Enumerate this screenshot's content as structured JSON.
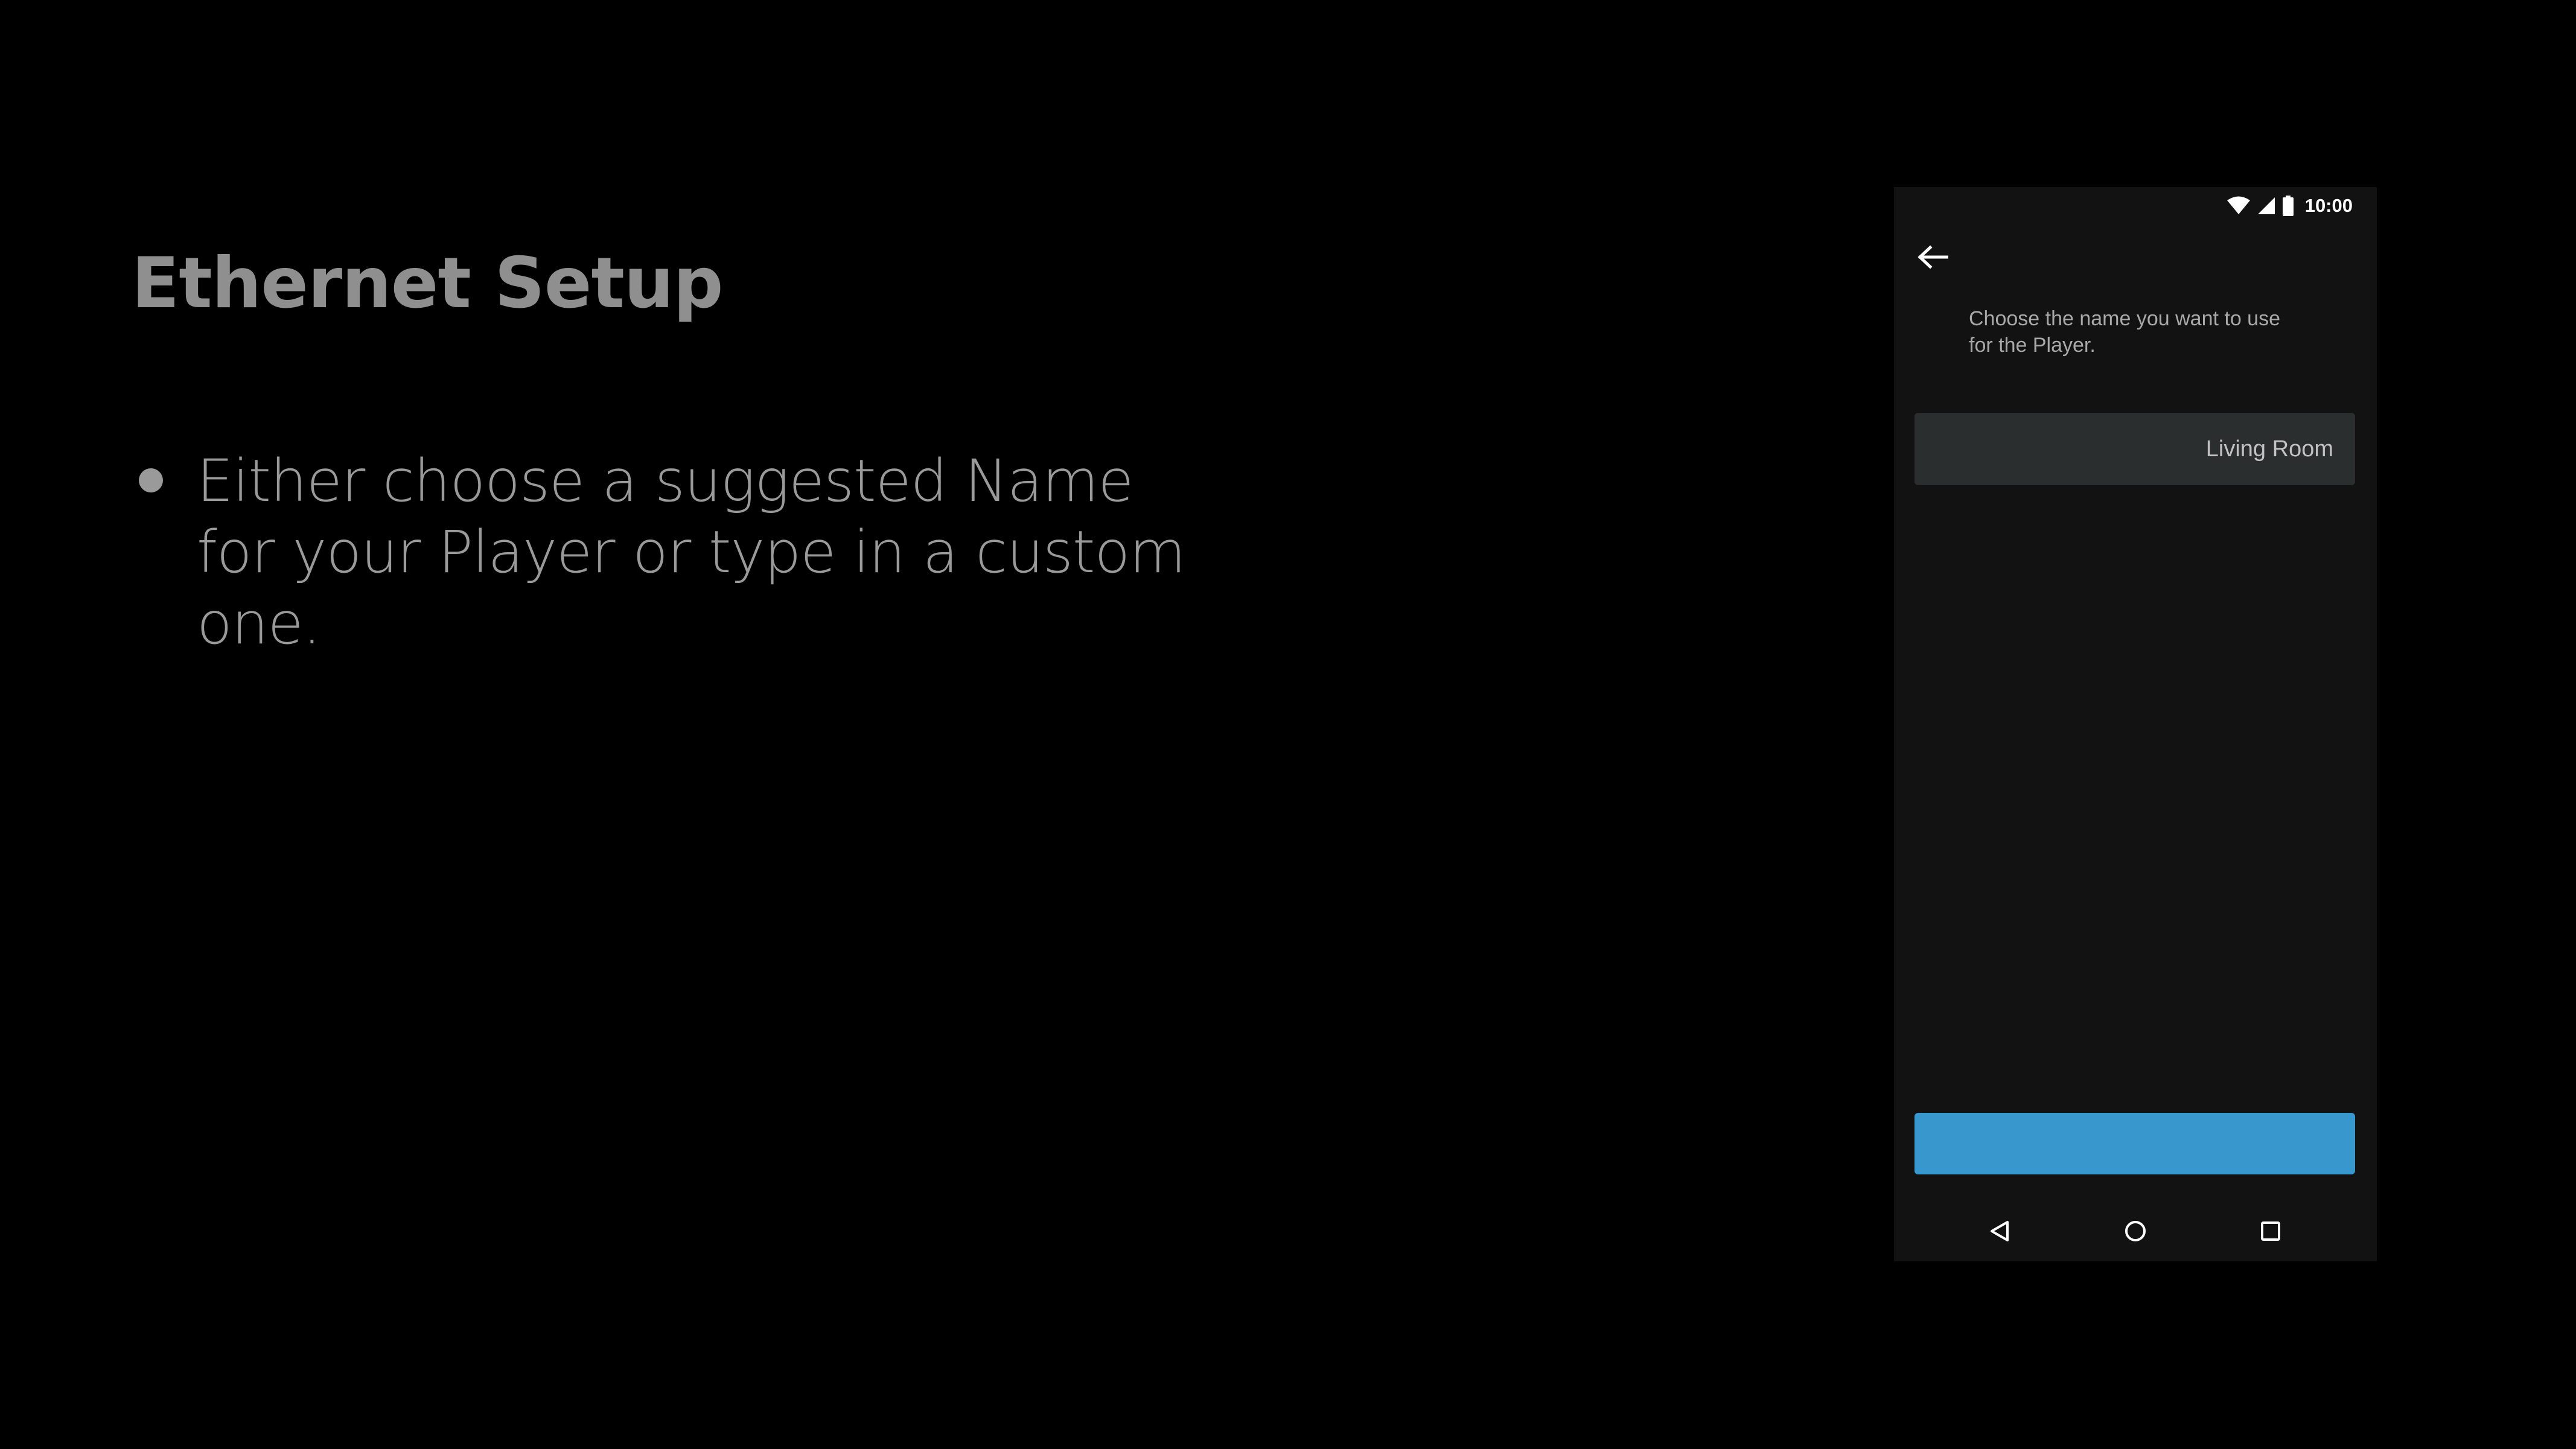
{
  "slide": {
    "title": "Ethernet Setup",
    "bullets": [
      "Either choose a suggested Name for your Player or type in a custom one."
    ]
  },
  "phone": {
    "status_bar": {
      "time": "10:00",
      "icons": [
        "wifi-icon",
        "cellular-signal-icon",
        "battery-icon"
      ]
    },
    "header": {
      "back_icon": "arrow-left-icon"
    },
    "instruction": "Choose the name you want to use for the Player.",
    "name_field": {
      "value": "Living Room"
    },
    "primary_button": {
      "label": "",
      "color": "#3897cd"
    },
    "nav_bar": {
      "icons": [
        "nav-back-icon",
        "nav-home-icon",
        "nav-recents-icon"
      ]
    }
  },
  "colors": {
    "background": "#000000",
    "phone_background": "#121212",
    "field_background": "#2b2e2f",
    "accent": "#3897cd",
    "slide_text": "#9a9a9a"
  }
}
